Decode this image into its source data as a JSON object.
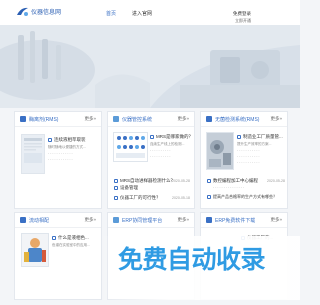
{
  "header": {
    "logo_text": "仪器信息网",
    "nav": [
      "首页",
      "进入官网"
    ],
    "actions": [
      "免费登录",
      "立即开通"
    ]
  },
  "cards": [
    {
      "title": "酶离剂(RMS)",
      "more": "更多»",
      "items": [
        {
          "text": "连续液相萃取装",
          "sub": "随时随地以便捷的方式..."
        },
        {
          "text": "",
          "sub": ""
        }
      ]
    },
    {
      "title": "仪器管控系统",
      "more": "更多»",
      "items": [
        {
          "text": "MRS是哪家做的？",
          "sub": "连续生产线上的检测..."
        },
        {
          "text": "MRS自动进样器检测什么？",
          "date": "2020-05-28"
        },
        {
          "text": "设备管理",
          "sub": ""
        },
        {
          "text": "仪器工厂的可行性？",
          "date": "2020-05-18"
        }
      ]
    },
    {
      "title": "无菌检测系统(RMS)",
      "more": "更多»",
      "items": [
        {
          "text": "制造业工厂质量管...",
          "sub": "提升生产效率的方案..."
        },
        {
          "text": "数控编程加工中心编程",
          "date": "2020-05-28"
        },
        {
          "text": "提高产品合格率的生产方式有哪些？",
          "date": "2020-05-11"
        }
      ]
    },
    {
      "title": "流动相配",
      "more": "更多»",
      "items": [
        {
          "text": "什么是液相色...",
          "sub": "色谱在实验室中的应用..."
        }
      ]
    },
    {
      "title": "ERP协同管理平台",
      "more": "更多»",
      "items": []
    },
    {
      "title": "ERP免费软件下载",
      "more": "更多»",
      "items": [
        {
          "text": "仪器工厂的...",
          "sub": ""
        }
      ]
    }
  ],
  "banner": {
    "text": "免费自动收录"
  },
  "colors": {
    "accent": "#3a70c5",
    "banner": "#2f9be3"
  }
}
